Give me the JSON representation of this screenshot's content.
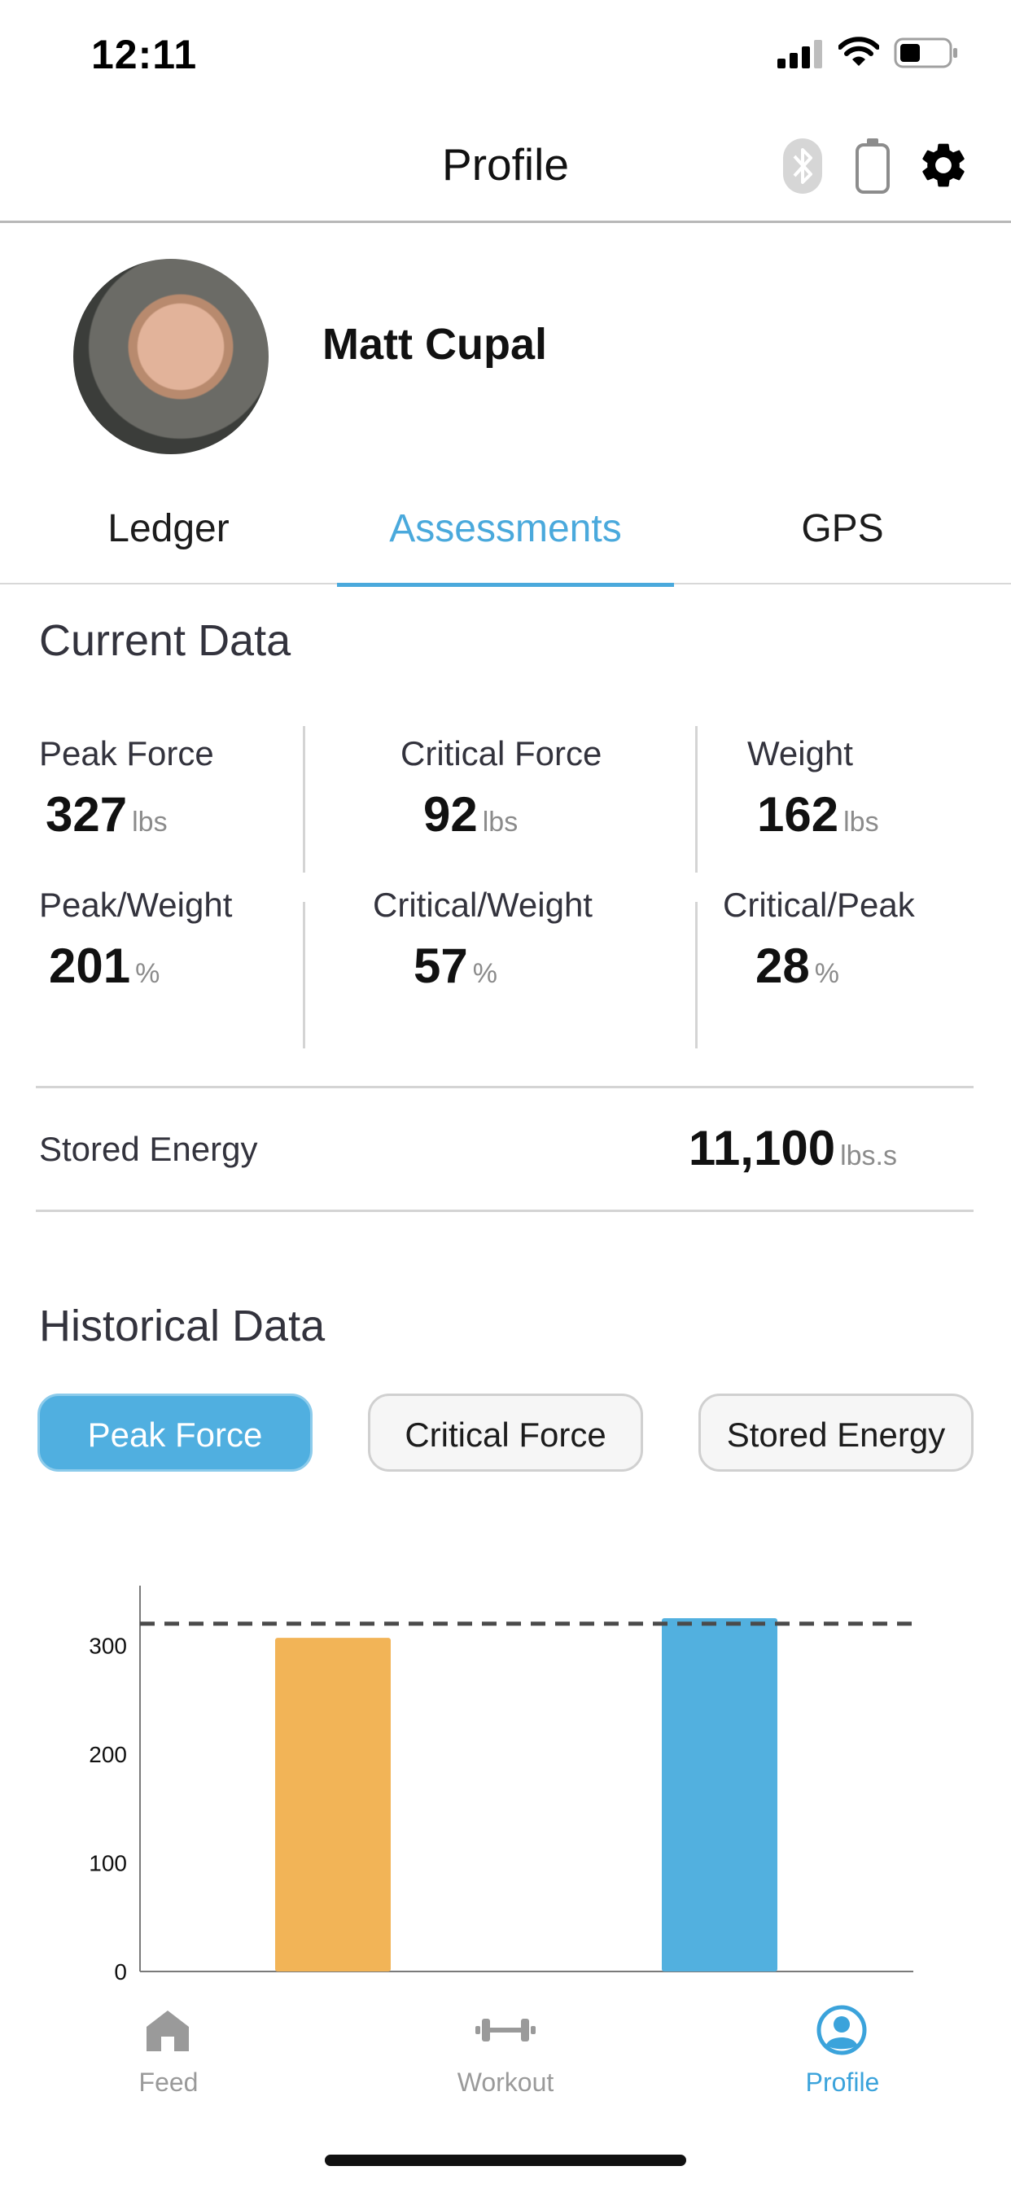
{
  "status_bar": {
    "time": "12:11"
  },
  "header": {
    "title": "Profile"
  },
  "profile": {
    "name": "Matt Cupal"
  },
  "tabs": [
    {
      "label": "Ledger"
    },
    {
      "label": "Assessments"
    },
    {
      "label": "GPS"
    }
  ],
  "current_data": {
    "title": "Current Data",
    "stats": [
      {
        "label": "Peak Force",
        "value": "327",
        "unit": "lbs"
      },
      {
        "label": "Critical Force",
        "value": "92",
        "unit": "lbs"
      },
      {
        "label": "Weight",
        "value": "162",
        "unit": "lbs"
      },
      {
        "label": "Peak/Weight",
        "value": "201",
        "unit": "%"
      },
      {
        "label": "Critical/Weight",
        "value": "57",
        "unit": "%"
      },
      {
        "label": "Critical/Peak",
        "value": "28",
        "unit": "%"
      }
    ],
    "stored_energy": {
      "label": "Stored Energy",
      "value": "11,100",
      "unit": "lbs.s"
    }
  },
  "historical_data": {
    "title": "Historical Data",
    "filters": [
      {
        "label": "Peak Force",
        "active": true
      },
      {
        "label": "Critical Force",
        "active": false
      },
      {
        "label": "Stored Energy",
        "active": false
      }
    ]
  },
  "chart_data": {
    "type": "bar",
    "title": "",
    "xlabel": "",
    "ylabel": "",
    "ylim": [
      0,
      355
    ],
    "yticks": [
      "0",
      "100",
      "200",
      "300"
    ],
    "values": [
      307,
      325
    ],
    "colors": [
      "#f2b457",
      "#52b0df"
    ],
    "reference_line": 320,
    "grid": false
  },
  "bottom_nav": [
    {
      "label": "Feed",
      "icon": "home-icon",
      "active": false
    },
    {
      "label": "Workout",
      "icon": "dumbbell-icon",
      "active": false
    },
    {
      "label": "Profile",
      "icon": "profile-icon",
      "active": true
    }
  ],
  "colors": {
    "accent": "#4aa9dc",
    "bar_orange": "#f2b457",
    "bar_blue": "#52b0df"
  }
}
